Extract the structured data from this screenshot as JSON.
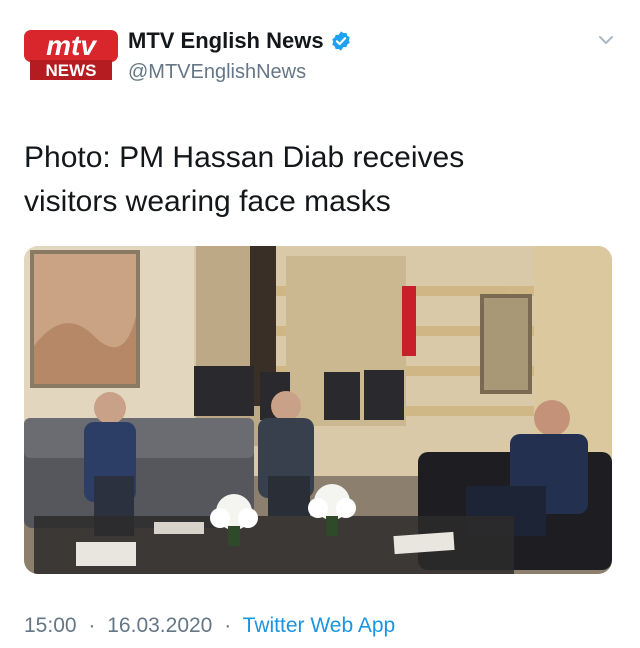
{
  "account": {
    "display_name": "MTV English News",
    "handle": "@MTVEnglishNews",
    "logo_text_top": "mtv",
    "logo_text_bottom": "NEWS"
  },
  "tweet": {
    "text_line1": "Photo: PM Hassan Diab receives",
    "text_line2": "visitors wearing face masks"
  },
  "meta": {
    "time": "15:00",
    "separator1": "·",
    "date": "16.03.2020",
    "separator2": "·",
    "source": "Twitter Web App"
  },
  "icons": {
    "verified": "verified-badge-icon",
    "menu": "chevron-down-icon"
  },
  "colors": {
    "logo_red": "#d9262c",
    "verified_blue": "#1da1f2",
    "link_blue": "#1b95e0",
    "secondary_text": "#657786"
  }
}
